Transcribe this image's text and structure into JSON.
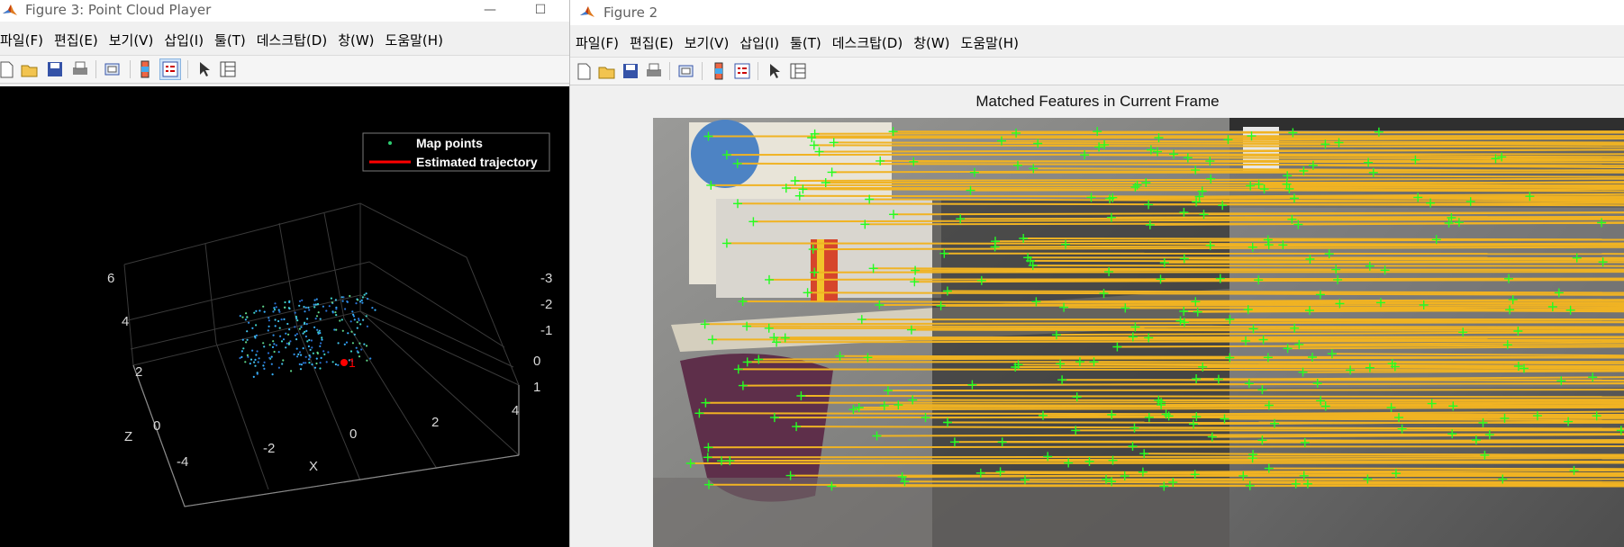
{
  "window1": {
    "title": "Figure 3: Point Cloud Player",
    "menu": [
      "파일(F)",
      "편집(E)",
      "보기(V)",
      "삽입(I)",
      "툴(T)",
      "데스크탑(D)",
      "창(W)",
      "도움말(H)"
    ],
    "legend": {
      "map_points": "Map points",
      "trajectory": "Estimated trajectory"
    },
    "axes": {
      "xlabel": "X",
      "zlabel": "Z",
      "x_ticks": [
        "-4",
        "-2",
        "0",
        "2",
        "4"
      ],
      "z_ticks": [
        "0",
        "2",
        "4",
        "6"
      ],
      "y_ticks": [
        "-3",
        "-2",
        "-1",
        "0",
        "1"
      ],
      "marker_label": "1"
    },
    "colors": {
      "background": "#000000",
      "trajectory": "#ff0000",
      "legend_marker": "#2ecc71"
    }
  },
  "window2": {
    "title": "Figure 2",
    "menu": [
      "파일(F)",
      "편집(E)",
      "보기(V)",
      "삽입(I)",
      "툴(T)",
      "데스크탑(D)",
      "창(W)",
      "도움말(H)"
    ],
    "figure_title": "Matched Features in Current Frame",
    "colors": {
      "match_line": "#f0b323",
      "feature_marker": "#22ff22"
    }
  }
}
